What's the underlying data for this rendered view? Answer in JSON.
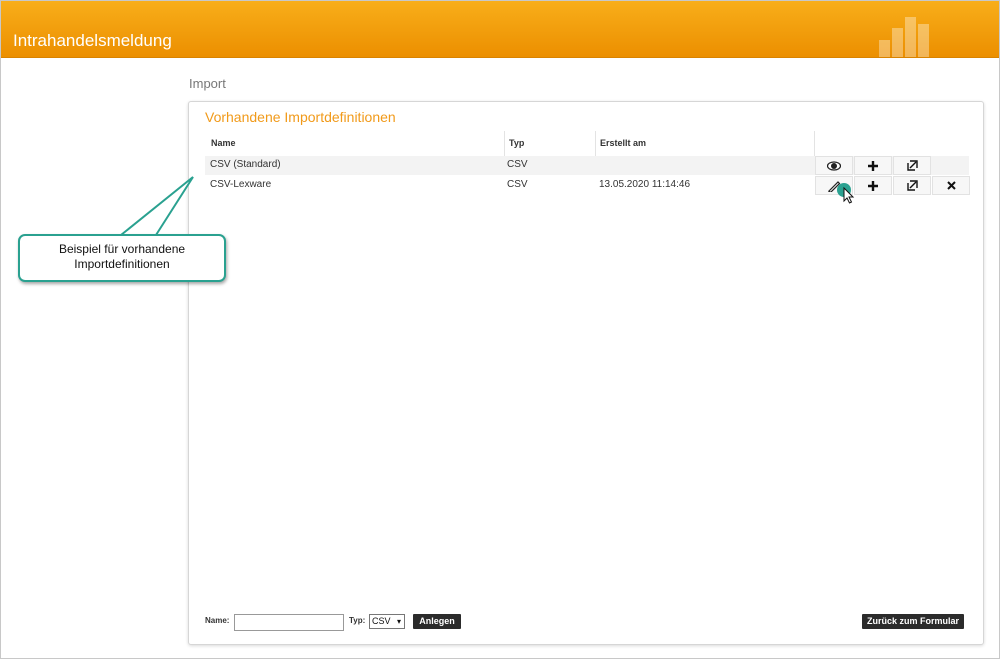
{
  "app": {
    "title": "Intrahandelsmeldung"
  },
  "breadcrumb": "Import",
  "panel": {
    "title": "Vorhandene Importdefinitionen",
    "columns": [
      "Name",
      "Typ",
      "Erstellt am"
    ],
    "rows": [
      {
        "name": "CSV (Standard)",
        "typ": "CSV",
        "erstellt": "",
        "actions": [
          "view-icon",
          "plus-icon",
          "export-icon"
        ]
      },
      {
        "name": "CSV-Lexware",
        "typ": "CSV",
        "erstellt": "13.05.2020 11:14:46",
        "actions": [
          "pencil-icon",
          "plus-icon",
          "export-icon",
          "close-icon"
        ]
      }
    ]
  },
  "footer": {
    "name_label": "Name:",
    "name_value": "",
    "typ_label": "Typ:",
    "typ_selected": "CSV",
    "create_label": "Anlegen",
    "back_label": "Zurück zum Formular"
  },
  "callout": {
    "text": "Beispiel für vorhandene Importdefinitionen"
  },
  "colors": {
    "header": "#f39c0f",
    "accent": "#f19a1a",
    "callout_border": "#2aa190"
  }
}
